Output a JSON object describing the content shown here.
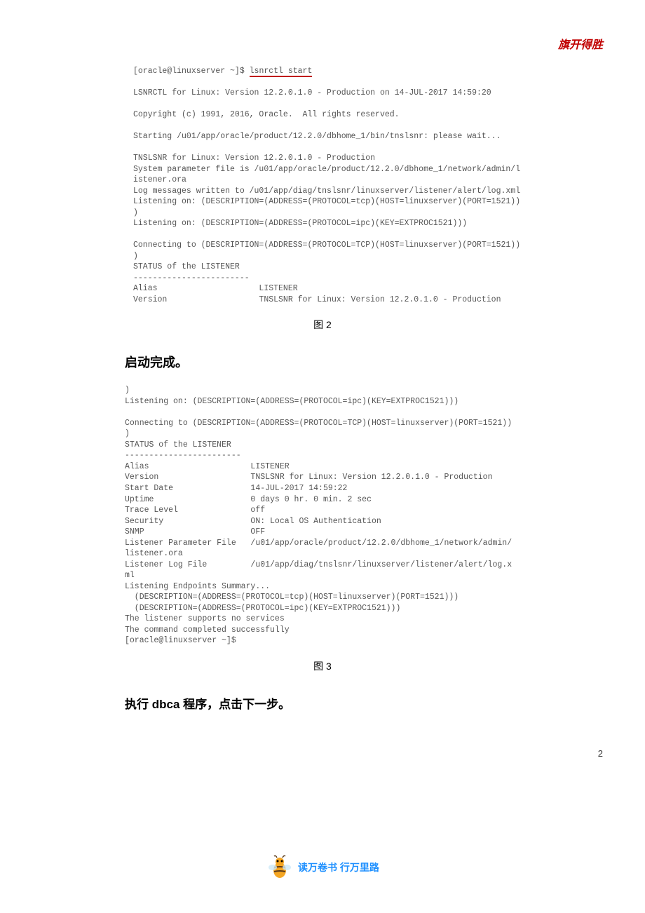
{
  "header": {
    "banner": "旗开得胜"
  },
  "figure2": {
    "prompt_prefix": "[oracle@linuxserver ~]$ ",
    "command": "lsnrctl start",
    "block_a": "LSNRCTL for Linux: Version 12.2.0.1.0 - Production on 14-JUL-2017 14:59:20\n\nCopyright (c) 1991, 2016, Oracle.  All rights reserved.\n\nStarting /u01/app/oracle/product/12.2.0/dbhome_1/bin/tnslsnr: please wait...\n\nTNSLSNR for Linux: Version 12.2.0.1.0 - Production\nSystem parameter file is /u01/app/oracle/product/12.2.0/dbhome_1/network/admin/l\nistener.ora\nLog messages written to /u01/app/diag/tnslsnr/linuxserver/listener/alert/log.xml\nListening on: (DESCRIPTION=(ADDRESS=(PROTOCOL=tcp)(HOST=linuxserver)(PORT=1521))\n)\nListening on: (DESCRIPTION=(ADDRESS=(PROTOCOL=ipc)(KEY=EXTPROC1521)))\n\nConnecting to (DESCRIPTION=(ADDRESS=(PROTOCOL=TCP)(HOST=linuxserver)(PORT=1521))\n)\nSTATUS of the LISTENER\n------------------------\nAlias                     LISTENER\nVersion                   TNSLSNR for Linux: Version 12.2.0.1.0 - Production",
    "caption": "图 2"
  },
  "heading1": "启动完成。",
  "figure3": {
    "block": ")\nListening on: (DESCRIPTION=(ADDRESS=(PROTOCOL=ipc)(KEY=EXTPROC1521)))\n\nConnecting to (DESCRIPTION=(ADDRESS=(PROTOCOL=TCP)(HOST=linuxserver)(PORT=1521))\n)\nSTATUS of the LISTENER\n------------------------\nAlias                     LISTENER\nVersion                   TNSLSNR for Linux: Version 12.2.0.1.0 - Production\nStart Date                14-JUL-2017 14:59:22\nUptime                    0 days 0 hr. 0 min. 2 sec\nTrace Level               off\nSecurity                  ON: Local OS Authentication\nSNMP                      OFF\nListener Parameter File   /u01/app/oracle/product/12.2.0/dbhome_1/network/admin/\nlistener.ora\nListener Log File         /u01/app/diag/tnslsnr/linuxserver/listener/alert/log.x\nml\nListening Endpoints Summary...\n  (DESCRIPTION=(ADDRESS=(PROTOCOL=tcp)(HOST=linuxserver)(PORT=1521)))\n  (DESCRIPTION=(ADDRESS=(PROTOCOL=ipc)(KEY=EXTPROC1521)))\nThe listener supports no services\nThe command completed successfully\n[oracle@linuxserver ~]$",
    "caption": "图 3"
  },
  "instruction": {
    "prefix": "执行 ",
    "cmd": "dbca",
    "middle": " 程序，点击",
    "bold2": "下一步",
    "suffix": "。"
  },
  "footer": {
    "text": "读万卷书 行万里路"
  },
  "pageNumber": "2"
}
